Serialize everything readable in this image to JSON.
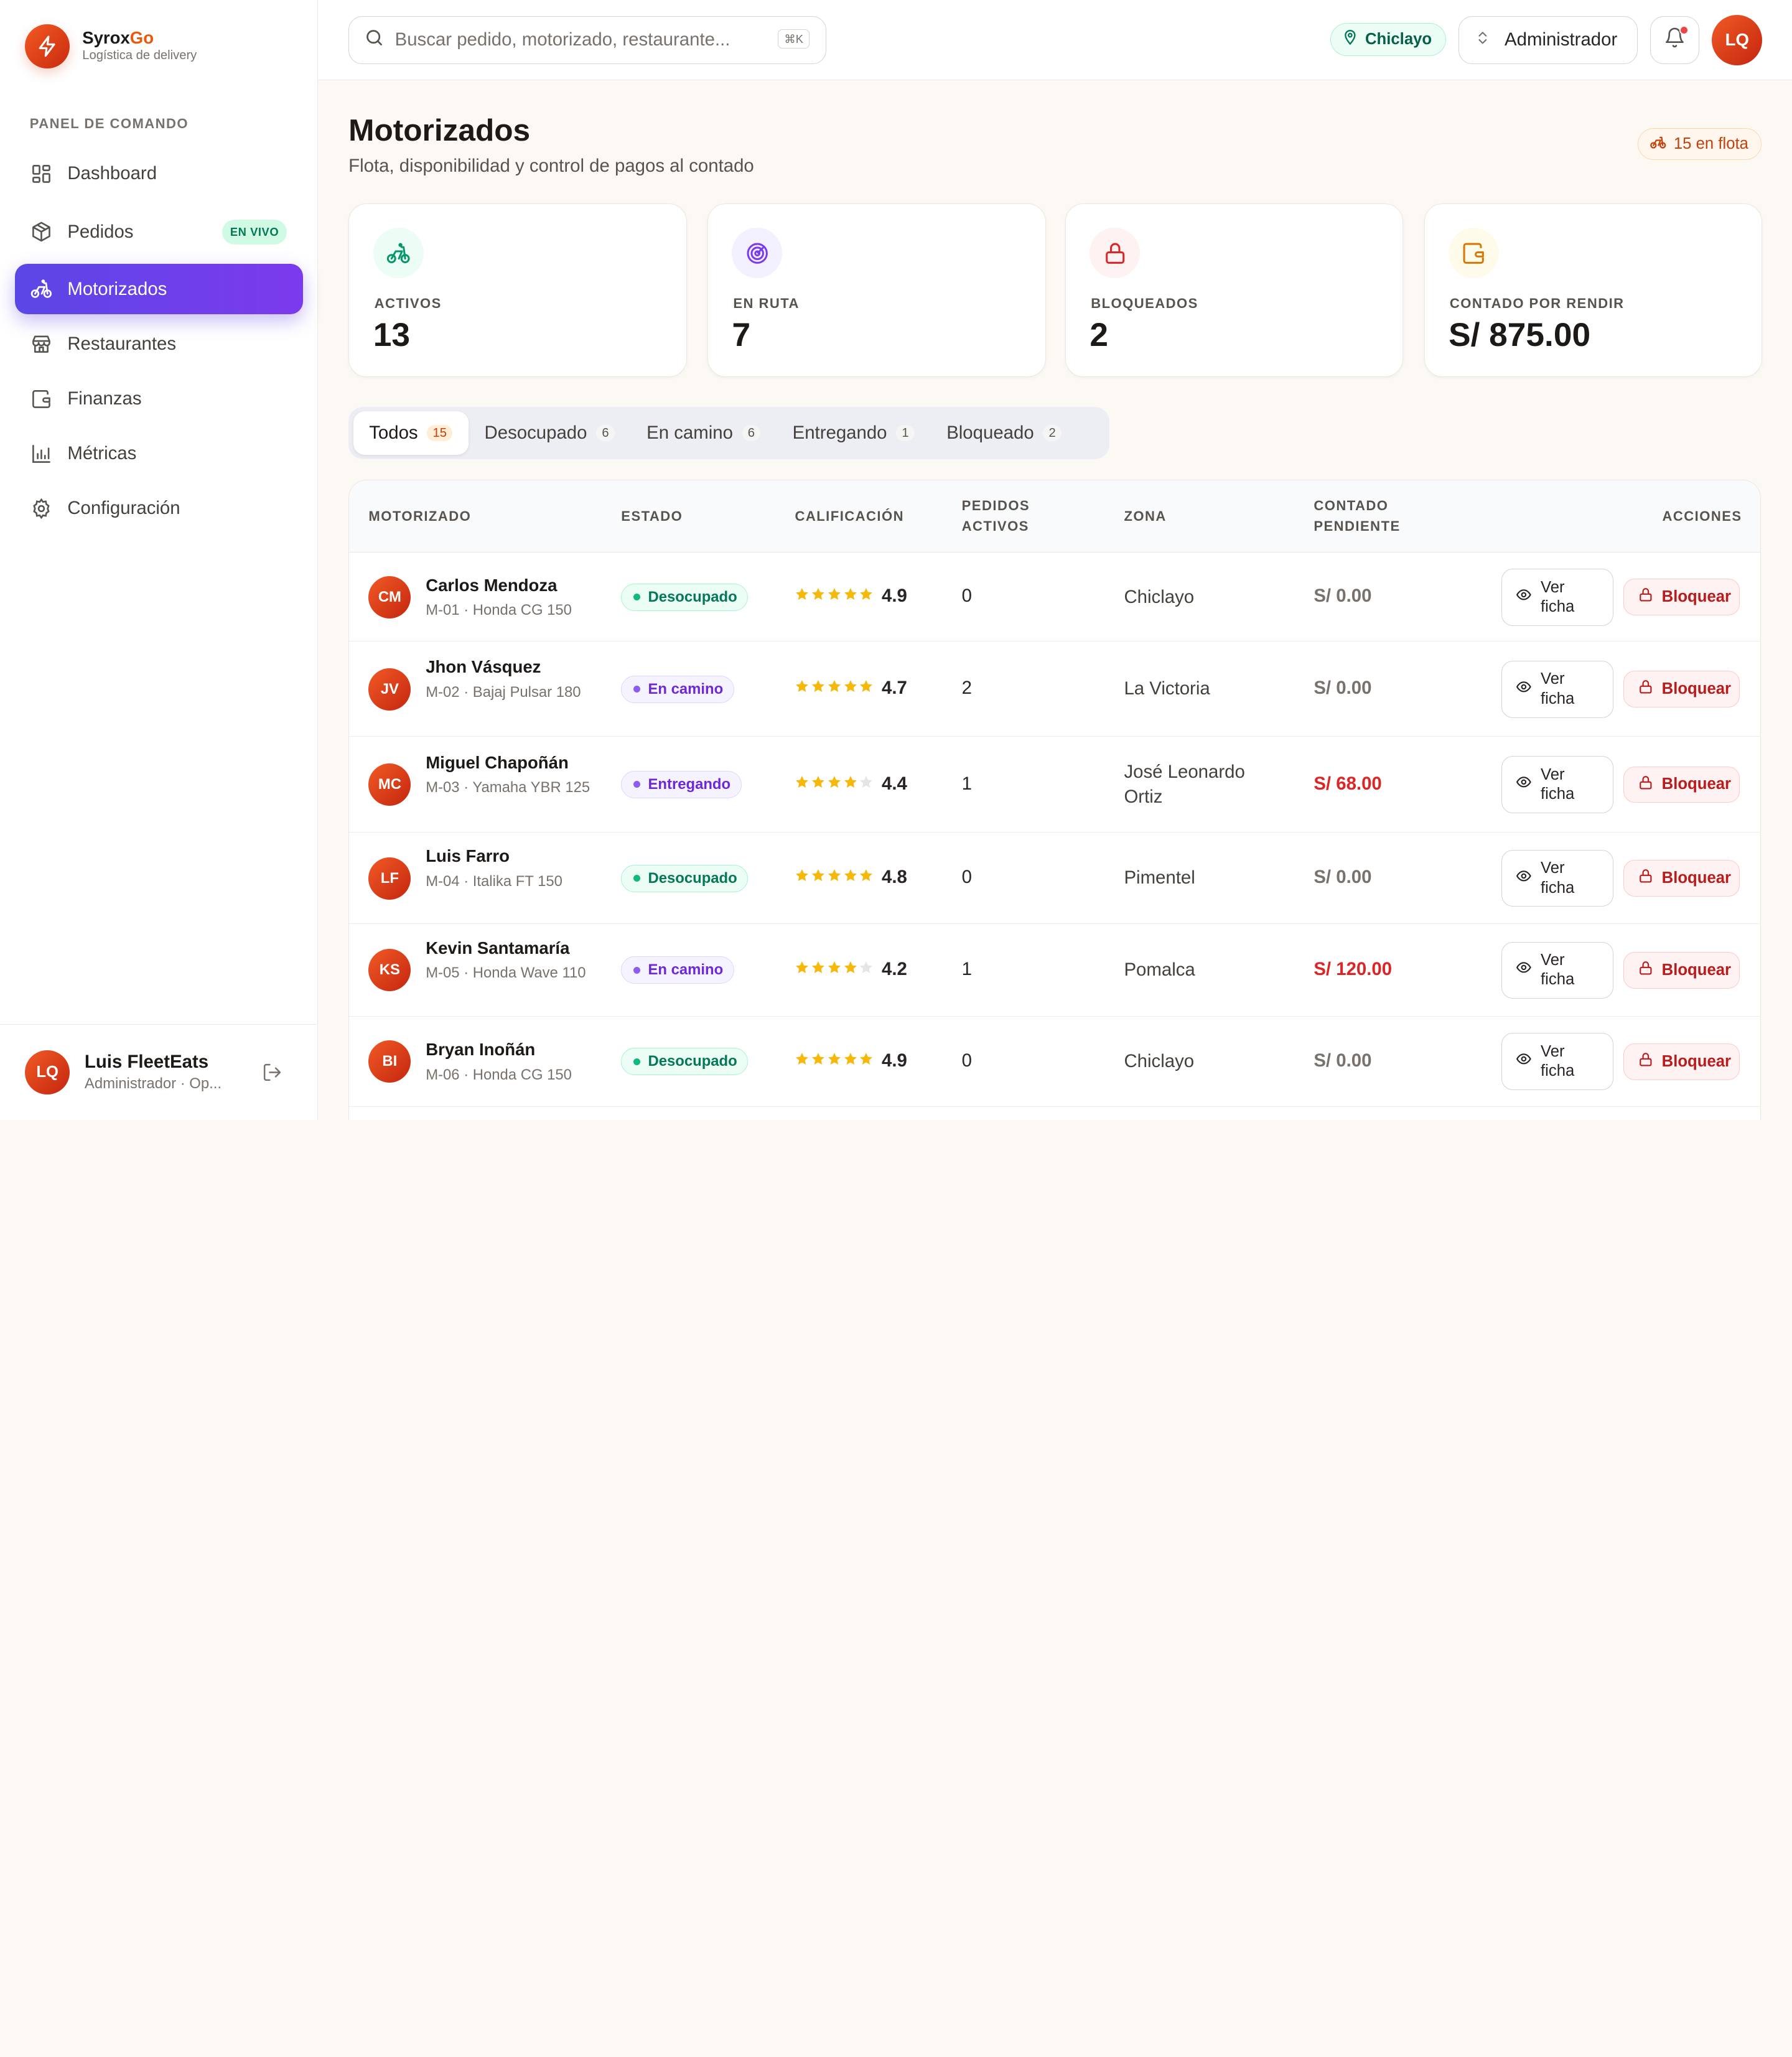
{
  "brand": {
    "name_a": "Syrox",
    "name_b": "Go",
    "subtitle": "Logística de delivery"
  },
  "sidebar": {
    "section": "PANEL DE COMANDO",
    "items": [
      {
        "label": "Dashboard",
        "icon": "grid-icon"
      },
      {
        "label": "Pedidos",
        "icon": "package-icon",
        "badge": "EN VIVO"
      },
      {
        "label": "Motorizados",
        "icon": "bike-icon",
        "active": true
      },
      {
        "label": "Restaurantes",
        "icon": "store-icon"
      },
      {
        "label": "Finanzas",
        "icon": "wallet-icon"
      },
      {
        "label": "Métricas",
        "icon": "chart-icon"
      },
      {
        "label": "Configuración",
        "icon": "gear-icon"
      }
    ],
    "user": {
      "initials": "LQ",
      "name": "Luis FleetEats",
      "role": "Administrador · Op..."
    }
  },
  "topbar": {
    "search_placeholder": "Buscar pedido, motorizado, restaurante...",
    "shortcut": "⌘K",
    "city": "Chiclayo",
    "role": "Administrador",
    "avatar": "LQ"
  },
  "page": {
    "title": "Motorizados",
    "subtitle": "Flota, disponibilidad y control de pagos al contado",
    "fleet_chip": "15 en flota"
  },
  "stats": [
    {
      "label": "ACTIVOS",
      "value": "13",
      "color": "#059669",
      "bg": "#ecfdf5"
    },
    {
      "label": "EN RUTA",
      "value": "7",
      "color": "#7c3aed",
      "bg": "#f3f0ff"
    },
    {
      "label": "BLOQUEADOS",
      "value": "2",
      "color": "#dc2626",
      "bg": "#fef2f2"
    },
    {
      "label": "CONTADO POR RENDIR",
      "value": "S/ 875.00",
      "color": "#d97706",
      "bg": "#fffbeb"
    }
  ],
  "tabs": [
    {
      "label": "Todos",
      "count": "15",
      "active": true
    },
    {
      "label": "Desocupado",
      "count": "6"
    },
    {
      "label": "En camino",
      "count": "6"
    },
    {
      "label": "Entregando",
      "count": "1"
    },
    {
      "label": "Bloqueado",
      "count": "2"
    }
  ],
  "table": {
    "headers": {
      "rider": "MOTORIZADO",
      "status": "ESTADO",
      "rating": "CALIFICACIÓN",
      "active_a": "PEDIDOS",
      "active_b": "ACTIVOS",
      "zone": "ZONA",
      "cash_a": "CONTADO",
      "cash_b": "PENDIENTE",
      "actions": "ACCIONES"
    },
    "view_label": "Ver ficha",
    "block_label": "Bloquear",
    "rows": [
      {
        "initials": "CM",
        "name": "Carlos Mendoza",
        "vehicle": "M-01 · Honda CG 150",
        "status": "Desocupado",
        "status_color": "green",
        "rating": 4.9,
        "score": "4.9",
        "active": "0",
        "zone": "Chiclayo",
        "cash": "S/ 0.00",
        "due": false
      },
      {
        "initials": "JV",
        "name": "Jhon Vásquez",
        "vehicle": "M-02 · Bajaj Pulsar 180",
        "status": "En camino",
        "status_color": "purple",
        "rating": 4.7,
        "score": "4.7",
        "active": "2",
        "zone": "La Victoria",
        "cash": "S/ 0.00",
        "due": false
      },
      {
        "initials": "MC",
        "name": "Miguel Chapoñán",
        "vehicle": "M-03 · Yamaha YBR 125",
        "status": "Entregando",
        "status_color": "purple",
        "rating": 4.4,
        "score": "4.4",
        "active": "1",
        "zone": "José Leonardo Ortiz",
        "cash": "S/ 68.00",
        "due": true
      },
      {
        "initials": "LF",
        "name": "Luis Farro",
        "vehicle": "M-04 · Italika FT 150",
        "status": "Desocupado",
        "status_color": "green",
        "rating": 4.8,
        "score": "4.8",
        "active": "0",
        "zone": "Pimentel",
        "cash": "S/ 0.00",
        "due": false
      },
      {
        "initials": "KS",
        "name": "Kevin Santamaría",
        "vehicle": "M-05 · Honda Wave 110",
        "status": "En camino",
        "status_color": "purple",
        "rating": 4.2,
        "score": "4.2",
        "active": "1",
        "zone": "Pomalca",
        "cash": "S/ 120.00",
        "due": true
      },
      {
        "initials": "BI",
        "name": "Bryan Inoñán",
        "vehicle": "M-06 · Honda CG 150",
        "status": "Desocupado",
        "status_color": "green",
        "rating": 4.9,
        "score": "4.9",
        "active": "0",
        "zone": "Chiclayo",
        "cash": "S/ 0.00",
        "due": false
      }
    ]
  }
}
